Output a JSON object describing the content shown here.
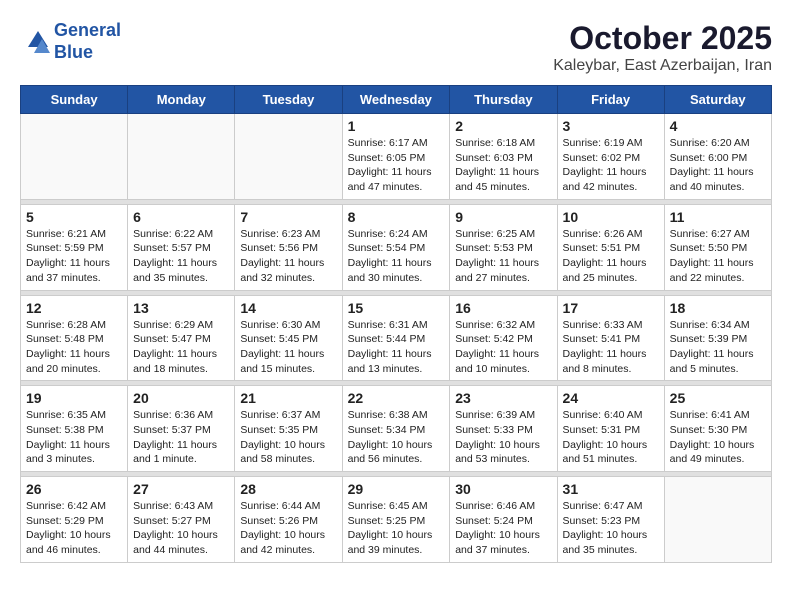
{
  "header": {
    "logo_line1": "General",
    "logo_line2": "Blue",
    "month_title": "October 2025",
    "subtitle": "Kaleybar, East Azerbaijan, Iran"
  },
  "weekdays": [
    "Sunday",
    "Monday",
    "Tuesday",
    "Wednesday",
    "Thursday",
    "Friday",
    "Saturday"
  ],
  "weeks": [
    [
      {
        "day": "",
        "info": ""
      },
      {
        "day": "",
        "info": ""
      },
      {
        "day": "",
        "info": ""
      },
      {
        "day": "1",
        "info": "Sunrise: 6:17 AM\nSunset: 6:05 PM\nDaylight: 11 hours and 47 minutes."
      },
      {
        "day": "2",
        "info": "Sunrise: 6:18 AM\nSunset: 6:03 PM\nDaylight: 11 hours and 45 minutes."
      },
      {
        "day": "3",
        "info": "Sunrise: 6:19 AM\nSunset: 6:02 PM\nDaylight: 11 hours and 42 minutes."
      },
      {
        "day": "4",
        "info": "Sunrise: 6:20 AM\nSunset: 6:00 PM\nDaylight: 11 hours and 40 minutes."
      }
    ],
    [
      {
        "day": "5",
        "info": "Sunrise: 6:21 AM\nSunset: 5:59 PM\nDaylight: 11 hours and 37 minutes."
      },
      {
        "day": "6",
        "info": "Sunrise: 6:22 AM\nSunset: 5:57 PM\nDaylight: 11 hours and 35 minutes."
      },
      {
        "day": "7",
        "info": "Sunrise: 6:23 AM\nSunset: 5:56 PM\nDaylight: 11 hours and 32 minutes."
      },
      {
        "day": "8",
        "info": "Sunrise: 6:24 AM\nSunset: 5:54 PM\nDaylight: 11 hours and 30 minutes."
      },
      {
        "day": "9",
        "info": "Sunrise: 6:25 AM\nSunset: 5:53 PM\nDaylight: 11 hours and 27 minutes."
      },
      {
        "day": "10",
        "info": "Sunrise: 6:26 AM\nSunset: 5:51 PM\nDaylight: 11 hours and 25 minutes."
      },
      {
        "day": "11",
        "info": "Sunrise: 6:27 AM\nSunset: 5:50 PM\nDaylight: 11 hours and 22 minutes."
      }
    ],
    [
      {
        "day": "12",
        "info": "Sunrise: 6:28 AM\nSunset: 5:48 PM\nDaylight: 11 hours and 20 minutes."
      },
      {
        "day": "13",
        "info": "Sunrise: 6:29 AM\nSunset: 5:47 PM\nDaylight: 11 hours and 18 minutes."
      },
      {
        "day": "14",
        "info": "Sunrise: 6:30 AM\nSunset: 5:45 PM\nDaylight: 11 hours and 15 minutes."
      },
      {
        "day": "15",
        "info": "Sunrise: 6:31 AM\nSunset: 5:44 PM\nDaylight: 11 hours and 13 minutes."
      },
      {
        "day": "16",
        "info": "Sunrise: 6:32 AM\nSunset: 5:42 PM\nDaylight: 11 hours and 10 minutes."
      },
      {
        "day": "17",
        "info": "Sunrise: 6:33 AM\nSunset: 5:41 PM\nDaylight: 11 hours and 8 minutes."
      },
      {
        "day": "18",
        "info": "Sunrise: 6:34 AM\nSunset: 5:39 PM\nDaylight: 11 hours and 5 minutes."
      }
    ],
    [
      {
        "day": "19",
        "info": "Sunrise: 6:35 AM\nSunset: 5:38 PM\nDaylight: 11 hours and 3 minutes."
      },
      {
        "day": "20",
        "info": "Sunrise: 6:36 AM\nSunset: 5:37 PM\nDaylight: 11 hours and 1 minute."
      },
      {
        "day": "21",
        "info": "Sunrise: 6:37 AM\nSunset: 5:35 PM\nDaylight: 10 hours and 58 minutes."
      },
      {
        "day": "22",
        "info": "Sunrise: 6:38 AM\nSunset: 5:34 PM\nDaylight: 10 hours and 56 minutes."
      },
      {
        "day": "23",
        "info": "Sunrise: 6:39 AM\nSunset: 5:33 PM\nDaylight: 10 hours and 53 minutes."
      },
      {
        "day": "24",
        "info": "Sunrise: 6:40 AM\nSunset: 5:31 PM\nDaylight: 10 hours and 51 minutes."
      },
      {
        "day": "25",
        "info": "Sunrise: 6:41 AM\nSunset: 5:30 PM\nDaylight: 10 hours and 49 minutes."
      }
    ],
    [
      {
        "day": "26",
        "info": "Sunrise: 6:42 AM\nSunset: 5:29 PM\nDaylight: 10 hours and 46 minutes."
      },
      {
        "day": "27",
        "info": "Sunrise: 6:43 AM\nSunset: 5:27 PM\nDaylight: 10 hours and 44 minutes."
      },
      {
        "day": "28",
        "info": "Sunrise: 6:44 AM\nSunset: 5:26 PM\nDaylight: 10 hours and 42 minutes."
      },
      {
        "day": "29",
        "info": "Sunrise: 6:45 AM\nSunset: 5:25 PM\nDaylight: 10 hours and 39 minutes."
      },
      {
        "day": "30",
        "info": "Sunrise: 6:46 AM\nSunset: 5:24 PM\nDaylight: 10 hours and 37 minutes."
      },
      {
        "day": "31",
        "info": "Sunrise: 6:47 AM\nSunset: 5:23 PM\nDaylight: 10 hours and 35 minutes."
      },
      {
        "day": "",
        "info": ""
      }
    ]
  ]
}
